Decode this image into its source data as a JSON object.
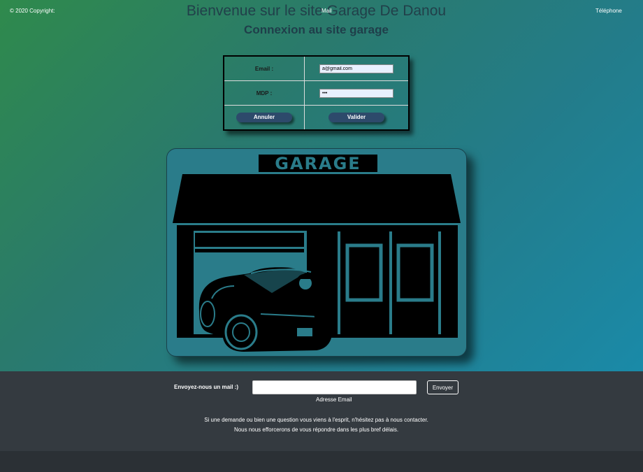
{
  "header": {
    "title": "Bienvenue sur le site Garage De Danou",
    "subtitle": "Connexion au site garage"
  },
  "login": {
    "email_label": "Email :",
    "email_value": "a@gmail.com",
    "password_label": "MDP :",
    "password_value": "•••",
    "cancel_label": "Annuler",
    "submit_label": "Valider"
  },
  "illustration": {
    "sign_text": "GARAGE"
  },
  "contact": {
    "label": "Envoyez-nous un mail :)",
    "email_value": "",
    "hint": "Adresse Email",
    "send_label": "Envoyer",
    "note_line1": "Si une demande ou bien une question vous viens à l'esprit, n'hésitez pas à nous contacter.",
    "note_line2": "Nous nous efforcerons de vous répondre dans les plus bref délais."
  },
  "footer": {
    "copyright": "© 2020 Copyright:",
    "mail": "Mail",
    "phone": "Téléphone"
  },
  "colors": {
    "gradient_start": "#2f8a4c",
    "gradient_end": "#1a8aa8",
    "footer_bg": "#343a40",
    "button_bg": "#2d4a6b"
  }
}
